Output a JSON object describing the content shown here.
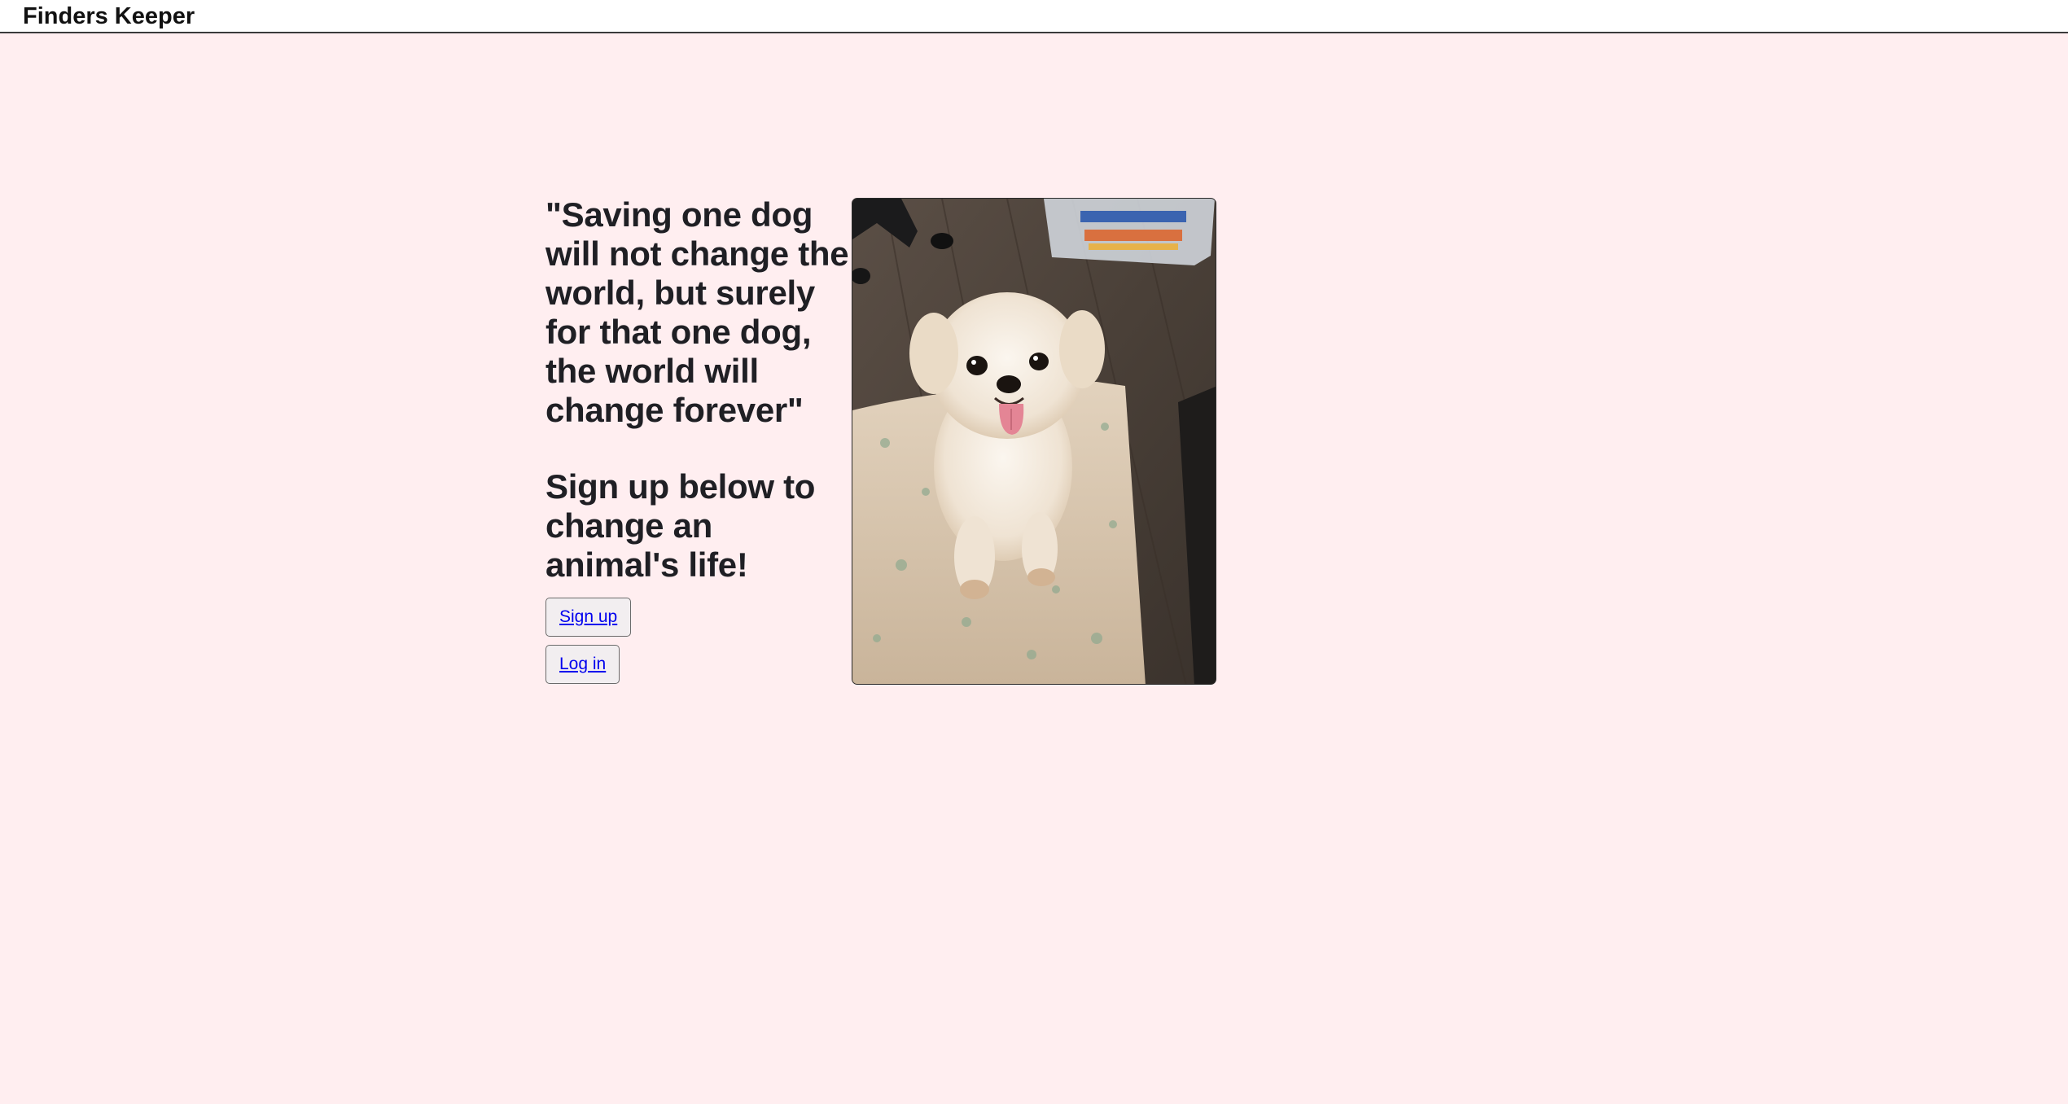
{
  "header": {
    "brand": "Finders Keeper"
  },
  "hero": {
    "quote": "\"Saving one dog will not change the world, but surely for that one dog, the world will change forever\"",
    "cta": "Sign up below to change an animal's life!",
    "signup_label": "Sign up",
    "login_label": "Log in",
    "photo_alt": "Small white dog sitting on a blanket"
  },
  "colors": {
    "background": "#ffeef0",
    "link": "#0000ee",
    "text": "#1f1f24"
  }
}
